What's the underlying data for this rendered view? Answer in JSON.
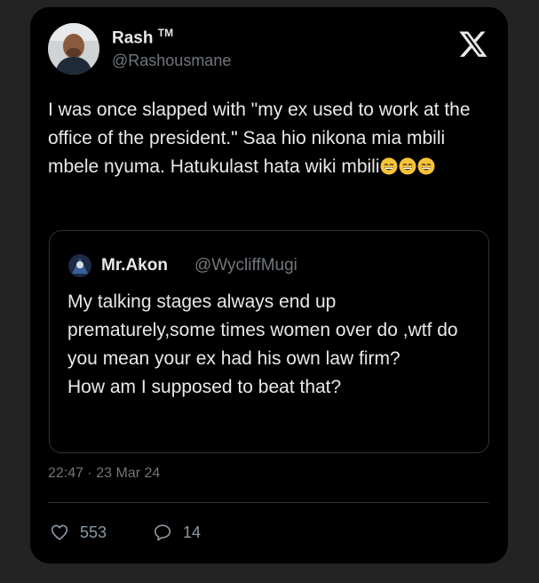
{
  "tweet": {
    "author": {
      "display_name": "Rash",
      "badge": "TM",
      "handle": "@Rashousmane"
    },
    "text": "I was once slapped with \"my ex used to work at the office of the president.\" Saa hio nikona mia mbili mbele nyuma. Hatukulast hata wiki mbili",
    "emojis": [
      "grinning-face-emoji",
      "grinning-face-emoji",
      "grinning-face-emoji"
    ],
    "quoted": {
      "display_name": "Mr.Akon",
      "handle": "@WycliffMugi",
      "text_line_1": "My talking stages always end up prematurely,some times women over do ,wtf do you mean your ex had his own law firm?",
      "text_line_2": "How am I supposed to beat that?"
    },
    "timestamp": "22:47 · 23 Mar 24",
    "stats": {
      "likes": "553",
      "replies": "14"
    }
  },
  "icons": {
    "logo": "x-logo-icon",
    "like": "heart-icon",
    "reply": "comment-icon"
  },
  "colors": {
    "background": "#000000",
    "text": "#e7e9ea",
    "secondary_text": "#71767b",
    "border": "#2f3336"
  }
}
